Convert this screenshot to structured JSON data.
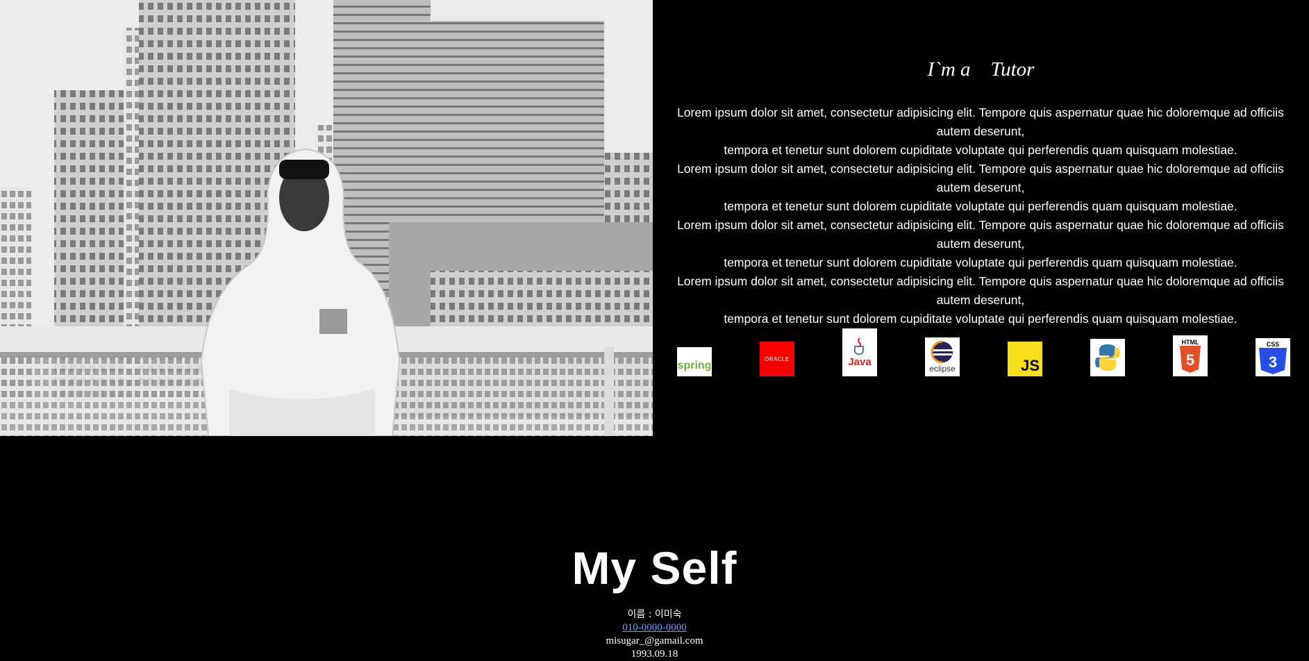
{
  "intro": {
    "title": "I`m a    Tutor",
    "paragraphs": [
      "Lorem ipsum dolor sit amet, consectetur adipisicing elit. Tempore quis aspernatur quae hic doloremque ad officiis autem deserunt,",
      "tempora et tenetur sunt dolorem cupiditate voluptate qui perferendis quam quisquam molestiae.",
      "Lorem ipsum dolor sit amet, consectetur adipisicing elit. Tempore quis aspernatur quae hic doloremque ad officiis autem deserunt,",
      "tempora et tenetur sunt dolorem cupiditate voluptate qui perferendis quam quisquam molestiae.",
      "Lorem ipsum dolor sit amet, consectetur adipisicing elit. Tempore quis aspernatur quae hic doloremque ad officiis autem deserunt,",
      "tempora et tenetur sunt dolorem cupiditate voluptate qui perferendis quam quisquam molestiae.",
      "Lorem ipsum dolor sit amet, consectetur adipisicing elit. Tempore quis aspernatur quae hic doloremque ad officiis autem deserunt,",
      "tempora et tenetur sunt dolorem cupiditate voluptate qui perferendis quam quisquam molestiae."
    ]
  },
  "skills": [
    {
      "name": "spring-logo",
      "label": "spring",
      "color": "#6db33f"
    },
    {
      "name": "oracle-logo",
      "label": "ORACLE",
      "color": "#f80000"
    },
    {
      "name": "java-logo",
      "label": "Java",
      "color": "#e11f21"
    },
    {
      "name": "eclipse-logo",
      "label": "eclipse",
      "color": "#2c2255"
    },
    {
      "name": "javascript-logo",
      "label": "JS",
      "color": "#f7df1e"
    },
    {
      "name": "python-logo",
      "label": "",
      "color": "#3776ab"
    },
    {
      "name": "html5-logo",
      "label": "HTML",
      "color": "#e34f26"
    },
    {
      "name": "css3-logo",
      "label": "CSS",
      "color": "#264de4"
    }
  ],
  "myself": {
    "heading": "My Self",
    "name_line": "이름 : 이미숙",
    "phone": "010-0000-0000",
    "email": "misugar_@gamail.com",
    "birth": "1993.09.18"
  }
}
